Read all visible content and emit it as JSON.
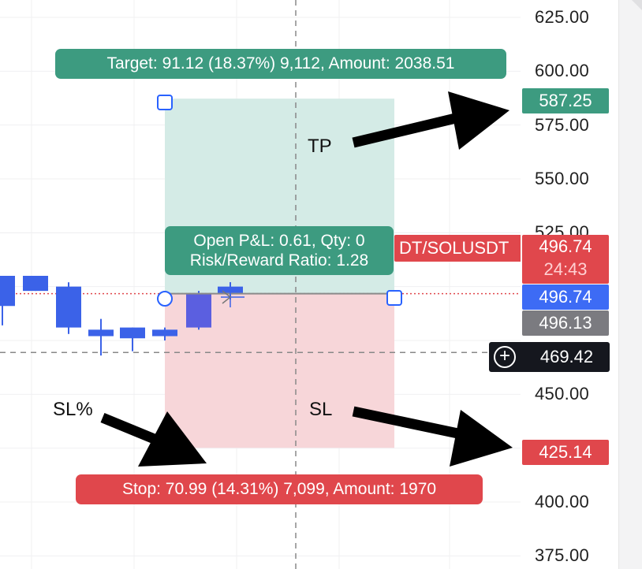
{
  "price_axis": {
    "ticks": [
      {
        "label": "625.00",
        "value": 625
      },
      {
        "label": "600.00",
        "value": 600
      },
      {
        "label": "575.00",
        "value": 575
      },
      {
        "label": "550.00",
        "value": 550
      },
      {
        "label": "525.00",
        "value": 525
      },
      {
        "label": "450.00",
        "value": 450
      },
      {
        "label": "425.00",
        "value": 425
      },
      {
        "label": "400.00",
        "value": 400
      },
      {
        "label": "375.00",
        "value": 375
      }
    ]
  },
  "badges": {
    "tp_price": "587.25",
    "last_price": "496.74",
    "countdown": "24:43",
    "entry_price": "496.74",
    "grey_price": "496.13",
    "crosshair_price": "469.42",
    "sl_price": "425.14"
  },
  "symbol_label": "DT/SOLUSDT",
  "position_tool": {
    "target_label": "Target: 91.12 (18.37%) 9,112, Amount: 2038.51",
    "stop_label": "Stop: 70.99 (14.31%) 7,099, Amount: 1970",
    "pnl_line1": "Open P&L: 0.61, Qty: 0",
    "pnl_line2": "Risk/Reward Ratio: 1.28",
    "entry": 496.74,
    "target": 587.25,
    "stop": 425.14
  },
  "annotations": {
    "tp": "TP",
    "sl": "SL",
    "sl_percent": "SL%"
  },
  "colors": {
    "profit": "#3d9b80",
    "loss": "#e0474c",
    "profit_zone": "#d4ebe6",
    "loss_zone": "#f7d6d9",
    "candle": "#3b62e8",
    "entry_badge": "#3d6bf5",
    "grey_badge": "#7b7b80",
    "dark_badge": "#15171e"
  },
  "candles": [
    {
      "o": 505,
      "h": 505,
      "l": 482,
      "c": 491
    },
    {
      "o": 505,
      "h": 505,
      "l": 498,
      "c": 498
    },
    {
      "o": 500,
      "h": 502,
      "l": 478,
      "c": 481
    },
    {
      "o": 480,
      "h": 485,
      "l": 468,
      "c": 477
    },
    {
      "o": 481,
      "h": 481,
      "l": 470,
      "c": 476
    },
    {
      "o": 480,
      "h": 481,
      "l": 475,
      "c": 477
    },
    {
      "o": 497,
      "h": 498,
      "l": 480,
      "c": 481
    },
    {
      "o": 500,
      "h": 502,
      "l": 494,
      "c": 497
    }
  ]
}
